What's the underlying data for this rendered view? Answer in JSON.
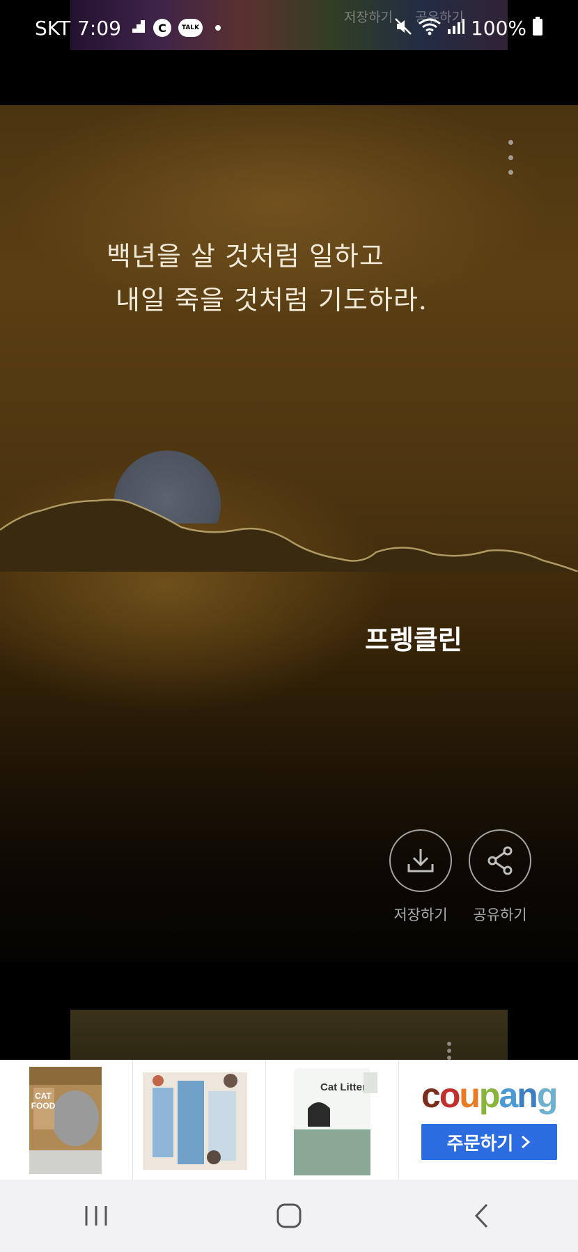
{
  "status_bar": {
    "carrier": "SKT",
    "time": "7:09",
    "c_icon": "C",
    "talk_icon": "TALK",
    "battery": "100%"
  },
  "prev_card": {
    "save_label": "저장하기",
    "share_label": "공유하기"
  },
  "card": {
    "quote_line1": "백년을 살 것처럼 일하고",
    "quote_line2": "내일 죽을 것처럼 기도하라.",
    "author": "프렝클린",
    "save_label": "저장하기",
    "share_label": "공유하기"
  },
  "ad": {
    "products": [
      {
        "name": "CAT FOOD",
        "icon": "cat-food-bag-image"
      },
      {
        "name": "",
        "icon": "cat-tunnel-box-image"
      },
      {
        "name": "Cat Litter",
        "icon": "cat-litter-bag-image"
      }
    ],
    "brand": "coupang",
    "cta": "주문하기",
    "cta_icon": "chevron-right-icon"
  },
  "nav": {
    "recents_icon": "recent-apps-icon",
    "home_icon": "home-icon",
    "back_icon": "back-icon"
  }
}
